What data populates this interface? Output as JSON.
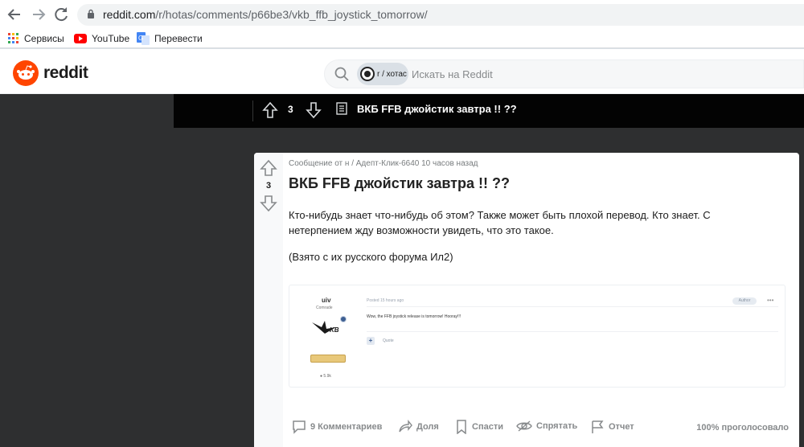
{
  "browser": {
    "url_host": "reddit.com",
    "url_path": "/r/hotas/comments/p66be3/vkb_ffb_joystick_tomorrow/",
    "bookmarks": [
      {
        "label": "Сервисы",
        "icon": "apps-grid-icon"
      },
      {
        "label": "YouTube",
        "icon": "youtube-icon"
      },
      {
        "label": "Перевести",
        "icon": "google-translate-icon"
      }
    ]
  },
  "header": {
    "logo_text": "reddit",
    "search_chip": "r / хотас",
    "search_placeholder": "Искать на Reddit"
  },
  "overlay": {
    "vote_count": "3",
    "title": "ВКБ FFB джойстик завтра !! ??"
  },
  "post": {
    "vote_count": "3",
    "meta": "Сообщение от н / Адепт-Клик-6640 10 часов назад",
    "title": "ВКБ FFB джойстик завтра !! ??",
    "body": "Кто-нибудь знает что-нибудь об этом? Также может быть плохой перевод. Кто знает. С нетерпением жду возможности увидеть, что это такое.",
    "note": "(Взято с их русского форума Ил2)",
    "embed": {
      "username": "uiv",
      "rank": "Comrade",
      "posted": "Posted 15 hours ago",
      "author_tag": "Author",
      "more": "•••",
      "text": "Wow, the FFB joystick release is tomorrow! Hooray!!!",
      "quote": "Quote",
      "stat": "5.9k"
    },
    "actions": {
      "comments": "9 Комментариев",
      "share": "Доля",
      "save": "Спасти",
      "hide": "Спрятать",
      "report": "Отчет",
      "upvoted": "100% проголосовало"
    }
  },
  "colors": {
    "reddit_orange": "#ff4500",
    "dark_bg": "#2e2f30",
    "overlay_bar": "#030303"
  }
}
